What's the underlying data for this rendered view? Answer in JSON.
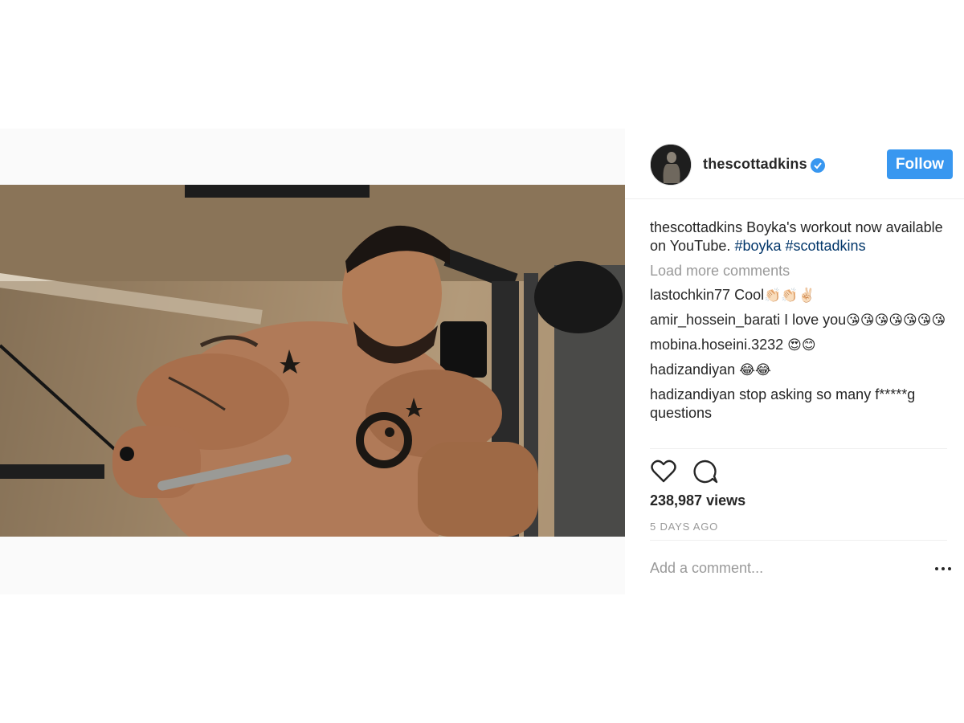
{
  "post": {
    "username": "thescottadkins",
    "follow_label": "Follow",
    "caption": {
      "username": "thescottadkins",
      "text": "Boyka's workout now available on YouTube.",
      "hashtags": [
        "#boyka",
        "#scottadkins"
      ]
    },
    "load_more": "Load more comments",
    "comments": [
      {
        "user": "lastochkin77",
        "text": "Cool",
        "emoji": "👏🏻👏🏻✌🏻"
      },
      {
        "user": "amir_hossein_barati",
        "text": "I love you",
        "emoji": "😘😘😘😘😘😘😘"
      },
      {
        "user": "mobina.hoseini.3232",
        "text": "",
        "emoji": "😍😊"
      },
      {
        "user": "hadizandiyan",
        "text": "",
        "emoji": "😂😂"
      },
      {
        "user": "hadizandiyan",
        "text": "stop asking so many f*****g questions",
        "emoji": ""
      }
    ],
    "views": "238,987 views",
    "time": "5 DAYS AGO",
    "add_comment_placeholder": "Add a comment...",
    "icons": [
      "verified-badge-icon",
      "heart-icon",
      "comment-icon",
      "more-options-icon"
    ],
    "colors": {
      "accent": "#3897f0",
      "hashtag": "#003569",
      "muted": "#999999",
      "text": "#262626"
    }
  }
}
